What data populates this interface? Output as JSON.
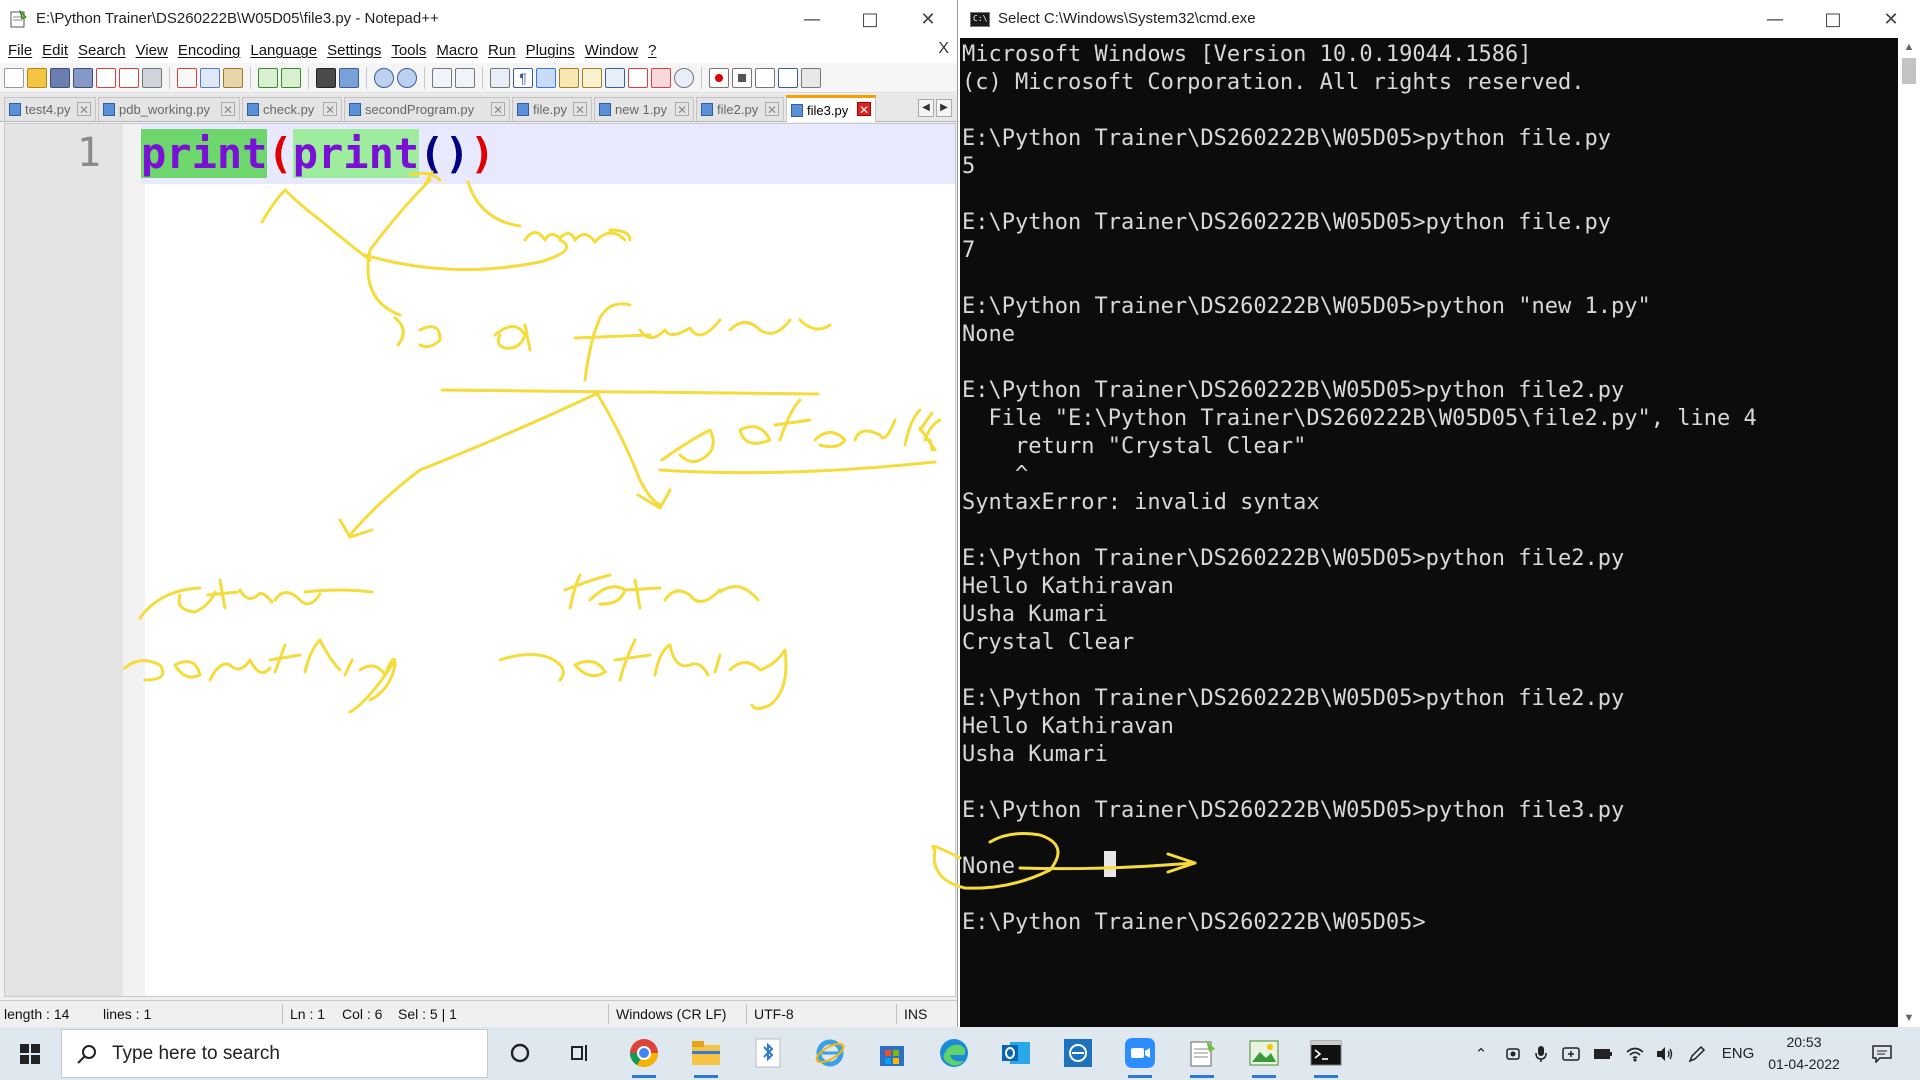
{
  "notepad": {
    "title": "E:\\Python Trainer\\DS260222B\\W05D05\\file3.py - Notepad++",
    "menu": [
      "File",
      "Edit",
      "Search",
      "View",
      "Encoding",
      "Language",
      "Settings",
      "Tools",
      "Macro",
      "Run",
      "Plugins",
      "Window",
      "?"
    ],
    "menu_close": "X",
    "tabs": [
      "test4.py",
      "pdb_working.py",
      "check.py",
      "secondProgram.py",
      "file.py",
      "new 1.py",
      "file2.py",
      "file3.py"
    ],
    "active_tab_index": 7,
    "line_number": "1",
    "code": {
      "kw1": "print",
      "open1": "(",
      "kw2": "print",
      "inner": "()",
      "close1": ")"
    },
    "status": {
      "length": "length : 14",
      "lines": "lines : 1",
      "ln": "Ln : 1",
      "col": "Col : 6",
      "sel": "Sel : 5 | 1",
      "eol": "Windows (CR LF)",
      "encoding": "UTF-8",
      "mode": "INS"
    }
  },
  "cmd": {
    "title": "Select C:\\Windows\\System32\\cmd.exe",
    "lines": [
      "Microsoft Windows [Version 10.0.19044.1586]",
      "(c) Microsoft Corporation. All rights reserved.",
      "",
      "E:\\Python Trainer\\DS260222B\\W05D05>python file.py",
      "5",
      "",
      "E:\\Python Trainer\\DS260222B\\W05D05>python file.py",
      "7",
      "",
      "E:\\Python Trainer\\DS260222B\\W05D05>python \"new 1.py\"",
      "None",
      "",
      "E:\\Python Trainer\\DS260222B\\W05D05>python file2.py",
      "  File \"E:\\Python Trainer\\DS260222B\\W05D05\\file2.py\", line 4",
      "    return \"Crystal Clear\"",
      "    ^",
      "SyntaxError: invalid syntax",
      "",
      "E:\\Python Trainer\\DS260222B\\W05D05>python file2.py",
      "Hello Kathiravan",
      "Usha Kumari",
      "Crystal Clear",
      "",
      "E:\\Python Trainer\\DS260222B\\W05D05>python file2.py",
      "Hello Kathiravan",
      "Usha Kumari",
      "",
      "E:\\Python Trainer\\DS260222B\\W05D05>python file3.py",
      "",
      "None",
      "",
      "E:\\Python Trainer\\DS260222B\\W05D05>"
    ]
  },
  "handwriting": {
    "ink_color": "#f5dc3c",
    "notes": [
      "None",
      "is a function",
      "default",
      "return something",
      "return nothing"
    ]
  },
  "taskbar": {
    "search_placeholder": "Type here to search",
    "language": "ENG",
    "time": "20:53",
    "date": "01-04-2022",
    "apps": [
      "cortana-icon",
      "task-view-icon",
      "chrome-icon",
      "file-explorer-icon",
      "bluetooth-app-icon",
      "internet-explorer-icon",
      "microsoft-store-icon",
      "edge-icon",
      "outlook-icon",
      "network-app-icon",
      "zoom-icon",
      "notepad-plus-plus-icon",
      "image-editor-icon",
      "cmd-icon"
    ]
  }
}
